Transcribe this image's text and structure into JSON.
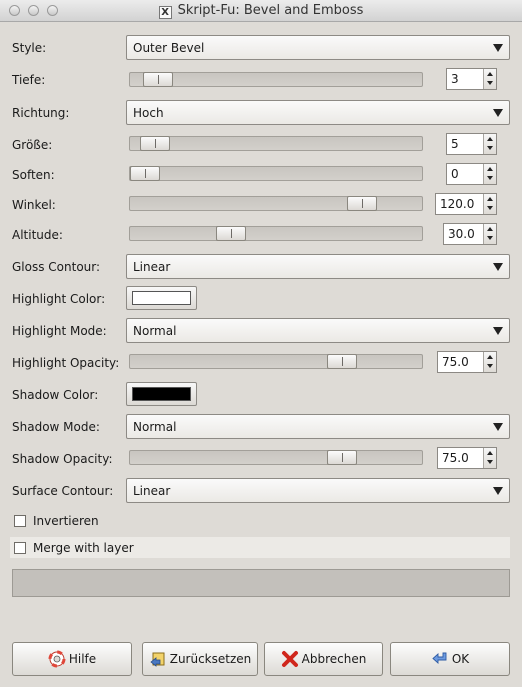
{
  "window": {
    "title": "Skript-Fu: Bevel and Emboss",
    "x_glyph": "X"
  },
  "fields": {
    "style": {
      "label": "Style:",
      "value": "Outer Bevel"
    },
    "tiefe": {
      "label": "Tiefe:",
      "value": "3",
      "level": 0.05
    },
    "richtung": {
      "label": "Richtung:",
      "value": "Hoch"
    },
    "groesse": {
      "label": "Größe:",
      "value": "5",
      "level": 0.04
    },
    "soften": {
      "label": "Soften:",
      "value": "0",
      "level": 0.0
    },
    "winkel": {
      "label": "Winkel:",
      "value": "120.0",
      "level": 0.83
    },
    "altitude": {
      "label": "Altitude:",
      "value": "30.0",
      "level": 0.33
    },
    "gloss_contour": {
      "label": "Gloss Contour:",
      "value": "Linear"
    },
    "highlight_color": {
      "label": "Highlight Color:",
      "color": "#ffffff"
    },
    "highlight_mode": {
      "label": "Highlight Mode:",
      "value": "Normal"
    },
    "highlight_opacity": {
      "label": "Highlight Opacity:",
      "value": "75.0",
      "level": 0.75
    },
    "shadow_color": {
      "label": "Shadow Color:",
      "color": "#000000"
    },
    "shadow_mode": {
      "label": "Shadow Mode:",
      "value": "Normal"
    },
    "shadow_opacity": {
      "label": "Shadow Opacity:",
      "value": "75.0",
      "level": 0.75
    },
    "surface_contour": {
      "label": "Surface Contour:",
      "value": "Linear"
    }
  },
  "checks": {
    "invertieren": {
      "label": "Invertieren",
      "checked": false
    },
    "merge": {
      "label": "Merge with layer",
      "checked": false
    }
  },
  "buttons": {
    "help": {
      "label": "Hilfe",
      "icon": "lifebuoy-icon"
    },
    "reset": {
      "label": "Zurücksetzen",
      "icon": "reset-icon"
    },
    "cancel": {
      "label": "Abbrechen",
      "icon": "cancel-icon"
    },
    "ok": {
      "label": "OK",
      "icon": "ok-arrow-icon"
    }
  },
  "colors": {
    "dialog_bg": "#dedbd6",
    "highlight": "#ffffff",
    "shadow": "#000000"
  }
}
